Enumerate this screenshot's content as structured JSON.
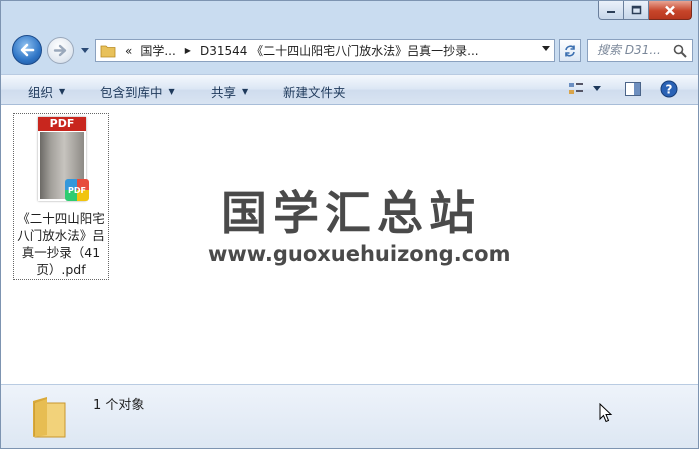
{
  "window": {
    "caption_icons": [
      "minimize-icon",
      "maximize-icon",
      "close-icon"
    ]
  },
  "address_bar": {
    "overflow": "«",
    "segments": [
      "国学...",
      "D31544 《二十四山阳宅八门放水法》吕真一抄录..."
    ],
    "search_placeholder": "搜索 D31..."
  },
  "toolbar": {
    "organize": "组织",
    "include_library": "包含到库中",
    "share": "共享",
    "new_folder": "新建文件夹"
  },
  "files": [
    {
      "name": "《二十四山阳宅八门放水法》吕真一抄录（41页）.pdf",
      "name_lines": [
        "《二十四山阳宅",
        "八门放水法》吕",
        "真一抄录（41",
        "页）.pdf"
      ],
      "thumb_label": "PDF",
      "badge_label": "PDF"
    }
  ],
  "watermark": {
    "title": "国学汇总站",
    "url": "www.guoxuehuizong.com"
  },
  "details": {
    "count": "1 个对象"
  },
  "colors": {
    "accent": "#1e395b",
    "pdf_red": "#c8261e"
  }
}
